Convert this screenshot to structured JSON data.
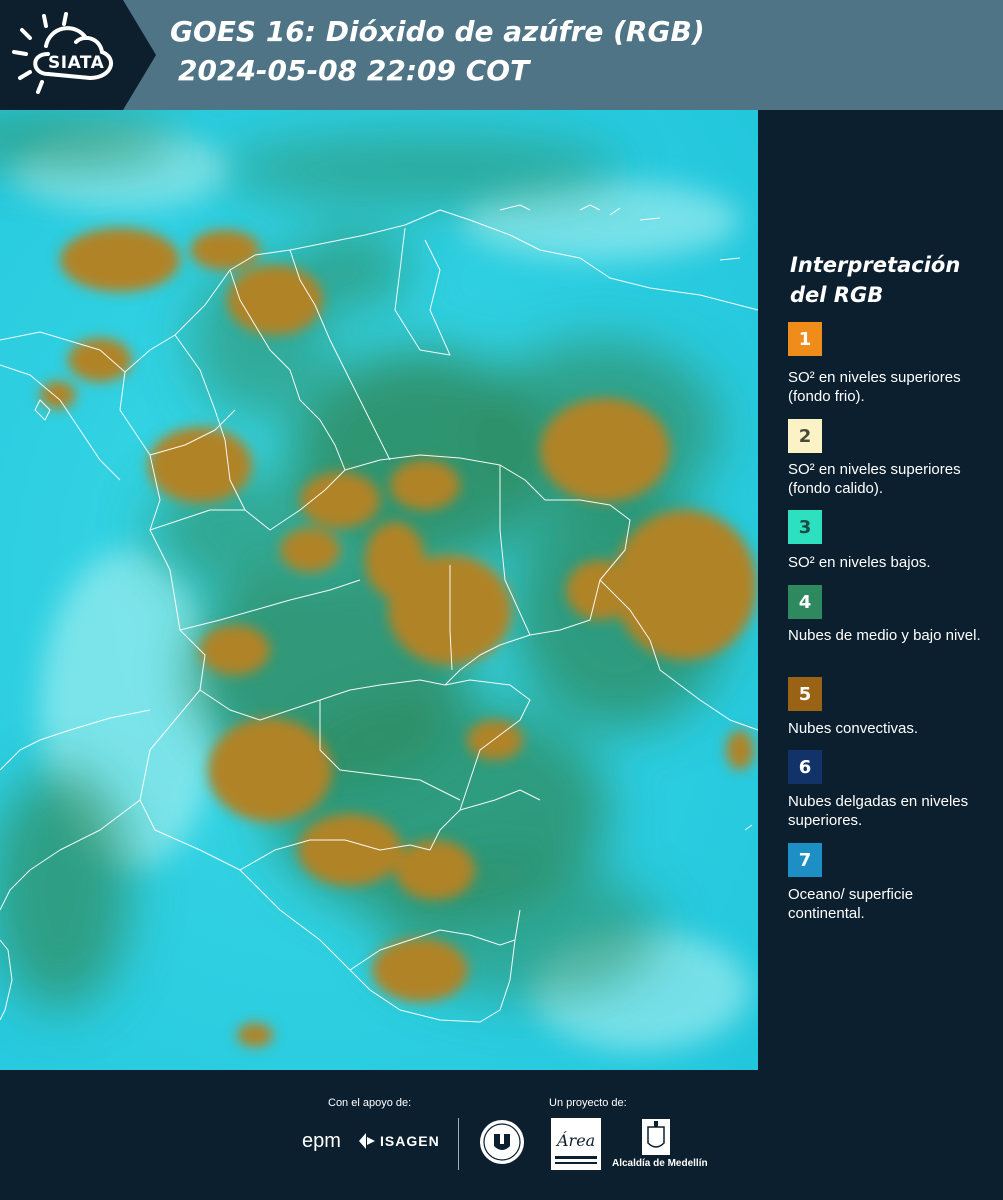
{
  "header": {
    "logo_text": "SIATA",
    "title_line1": "GOES 16: Dióxido de azúfre (RGB)",
    "title_line2": "2024-05-08 22:09 COT"
  },
  "legend": {
    "title_line1": "Interpretación",
    "title_line2": "del RGB",
    "items": [
      {
        "num": "1",
        "color": "#f08c1a",
        "num_color": "#ffffff",
        "label": "SO² en niveles superiores (fondo frio)."
      },
      {
        "num": "2",
        "color": "#fbf3c6",
        "num_color": "#4a4a3a",
        "label": "SO² en niveles superiores (fondo calido)."
      },
      {
        "num": "3",
        "color": "#2ce0c0",
        "num_color": "#1c4a44",
        "label": "SO² en niveles bajos."
      },
      {
        "num": "4",
        "color": "#2e8a5e",
        "num_color": "#ffffff",
        "label": "Nubes de medio y bajo nivel."
      },
      {
        "num": "5",
        "color": "#9a6214",
        "num_color": "#ffffff",
        "label": "Nubes convectivas."
      },
      {
        "num": "6",
        "color": "#12336a",
        "num_color": "#ffffff",
        "label": "Nubes delgadas en niveles superiores."
      },
      {
        "num": "7",
        "color": "#1e8fc4",
        "num_color": "#ffffff",
        "label": "Oceano/ superficie continental."
      }
    ]
  },
  "footer": {
    "support_label": "Con el apoyo de:",
    "project_label": "Un proyecto de:",
    "epm_logo": "epm",
    "isagen_logo": "ISAGEN",
    "area_logo": "Área",
    "alcaldia_label": "Alcaldía de Medellín"
  },
  "colors": {
    "header_dark": "#0d1e2c",
    "header_band": "#4e7485",
    "ocean": "#2fd4e8",
    "clouds_mid": "#2e8a5e",
    "clouds_convective": "#b08328",
    "borders": "#ffffff"
  }
}
